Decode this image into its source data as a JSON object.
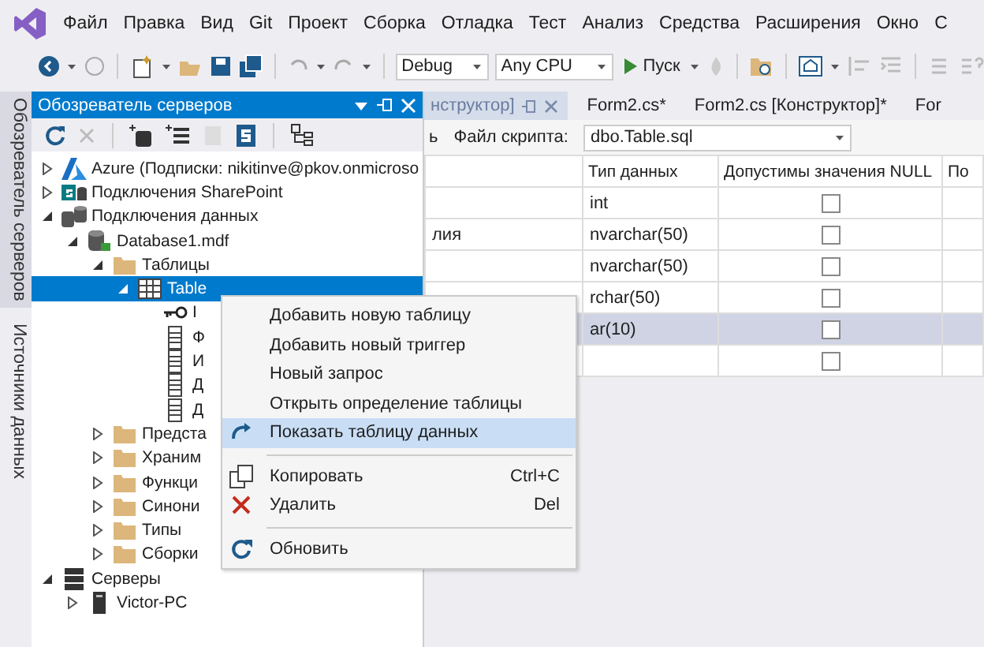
{
  "menubar": {
    "items": [
      "Файл",
      "Правка",
      "Вид",
      "Git",
      "Проект",
      "Сборка",
      "Отладка",
      "Тест",
      "Анализ",
      "Средства",
      "Расширения",
      "Окно",
      "С"
    ]
  },
  "toolbar": {
    "configuration": "Debug",
    "platform": "Any CPU",
    "start": "Пуск"
  },
  "side_tabs": [
    {
      "label": "Обозреватель серверов",
      "selected": true
    },
    {
      "label": "Источники данных",
      "selected": false
    }
  ],
  "server_explorer": {
    "title": "Обозреватель серверов",
    "tree": [
      {
        "kind": "azure",
        "label": "Azure (Подписки: nikitinve@pkov.onmicroso",
        "expanded": false,
        "selected": false
      },
      {
        "kind": "sharepoint",
        "label": "Подключения SharePoint",
        "expanded": false,
        "selected": false
      },
      {
        "kind": "connections",
        "label": "Подключения данных",
        "expanded": true,
        "selected": false,
        "children": [
          {
            "kind": "database",
            "label": "Database1.mdf",
            "expanded": true,
            "selected": false,
            "children": [
              {
                "kind": "folder",
                "label": "Таблицы",
                "expanded": true,
                "selected": false,
                "children": [
                  {
                    "kind": "table",
                    "label": "Table",
                    "expanded": true,
                    "selected": true,
                    "children": [
                      {
                        "kind": "key-column",
                        "label": "I",
                        "selected": false
                      },
                      {
                        "kind": "column",
                        "label": "Ф",
                        "selected": false
                      },
                      {
                        "kind": "column",
                        "label": "И",
                        "selected": false
                      },
                      {
                        "kind": "column",
                        "label": "Д",
                        "selected": false
                      },
                      {
                        "kind": "column",
                        "label": "Д",
                        "selected": false
                      }
                    ]
                  }
                ]
              },
              {
                "kind": "folder",
                "label": "Предста",
                "expanded": false,
                "selected": false
              },
              {
                "kind": "folder",
                "label": "Храним",
                "expanded": false,
                "selected": false
              },
              {
                "kind": "folder",
                "label": "Функци",
                "expanded": false,
                "selected": false
              },
              {
                "kind": "folder",
                "label": "Синони",
                "expanded": false,
                "selected": false
              },
              {
                "kind": "folder",
                "label": "Типы",
                "expanded": false,
                "selected": false
              },
              {
                "kind": "folder",
                "label": "Сборки",
                "expanded": false,
                "selected": false
              }
            ]
          }
        ]
      },
      {
        "kind": "servers",
        "label": "Серверы",
        "expanded": true,
        "selected": false,
        "children": [
          {
            "kind": "computer",
            "label": "Victor-PC",
            "expanded": false,
            "selected": false
          }
        ]
      }
    ]
  },
  "document_tabs": [
    {
      "label": "нструктор]",
      "selected": true
    },
    {
      "label": "Form2.cs*",
      "selected": false
    },
    {
      "label": "Form2.cs [Конструктор]*",
      "selected": false
    },
    {
      "label": "For",
      "selected": false
    }
  ],
  "script_bar": {
    "cut_label": "ь",
    "script_label": "Файл скрипта:",
    "script_file": "dbo.Table.sql"
  },
  "grid": {
    "columns": [
      "Тип данных",
      "Допустимы значения NULL",
      "По"
    ],
    "rows": [
      {
        "type": "int",
        "allow_null": false,
        "selected": false
      },
      {
        "column_1": "лия",
        "type": "nvarchar(50)",
        "allow_null": false,
        "selected": false
      },
      {
        "type": "nvarchar(50)",
        "allow_null": false,
        "selected": false
      },
      {
        "type": "rchar(50)",
        "allow_null": false,
        "selected": false
      },
      {
        "type": "ar(10)",
        "allow_null": false,
        "selected": true
      },
      {
        "allow_null": false,
        "selected": false
      }
    ]
  },
  "context_menu": {
    "items": [
      {
        "kind": "item",
        "label": "Добавить новую таблицу",
        "selected": false
      },
      {
        "kind": "item",
        "label": "Добавить новый триггер",
        "selected": false
      },
      {
        "kind": "item",
        "label": "Новый запрос",
        "selected": false
      },
      {
        "kind": "item",
        "label": "Открыть определение таблицы",
        "selected": false
      },
      {
        "kind": "item",
        "label": "Показать таблицу данных",
        "selected": true
      },
      {
        "kind": "separator"
      },
      {
        "kind": "item",
        "label": "Копировать",
        "shortcut": "Ctrl+C",
        "selected": false
      },
      {
        "kind": "item",
        "label": "Удалить",
        "shortcut": "Del",
        "selected": false
      },
      {
        "kind": "separator"
      },
      {
        "kind": "item",
        "label": "Обновить",
        "selected": false
      }
    ]
  }
}
